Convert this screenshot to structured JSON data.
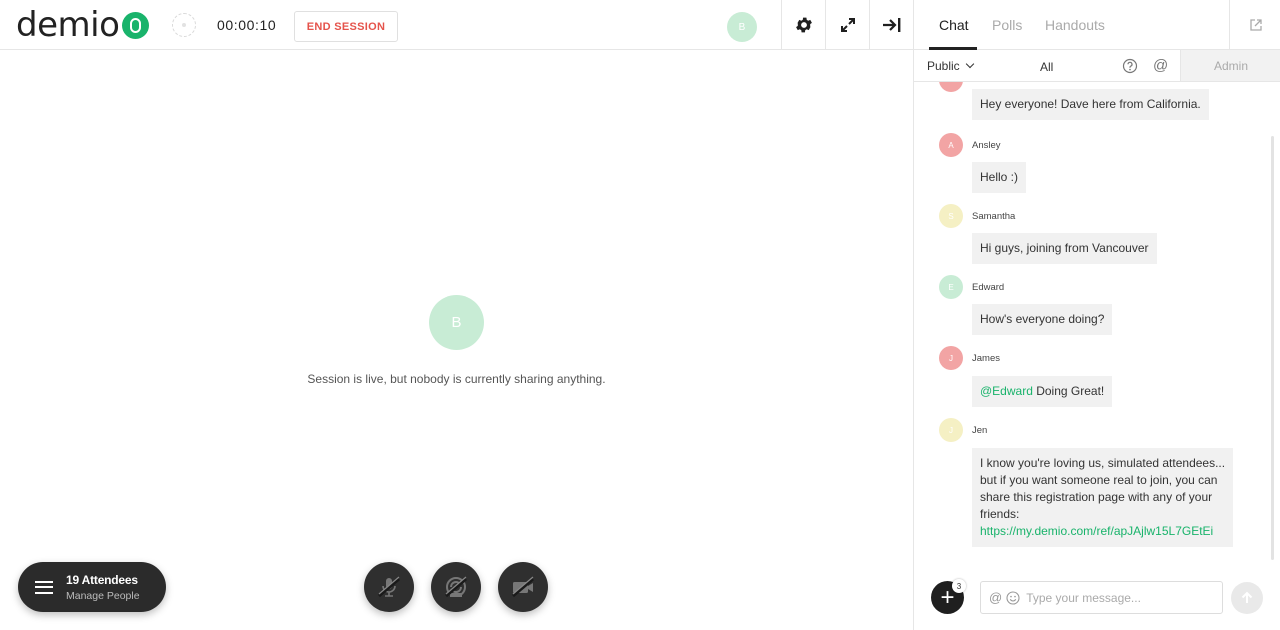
{
  "header": {
    "logo_text": "demio",
    "timer": "00:00:10",
    "end_session_label": "END SESSION",
    "host_avatar_initial": "B"
  },
  "stage": {
    "avatar_initial": "B",
    "message": "Session is live, but nobody is currently sharing anything."
  },
  "attendees": {
    "count_label": "19 Attendees",
    "sub_label": "Manage People"
  },
  "panel": {
    "tabs": [
      {
        "label": "Chat",
        "active": true
      },
      {
        "label": "Polls",
        "active": false
      },
      {
        "label": "Handouts",
        "active": false
      }
    ],
    "filter": {
      "visibility": "Public",
      "audience": "All",
      "admin_label": "Admin"
    }
  },
  "chat": {
    "messages": [
      {
        "name": "",
        "initial": "",
        "color": "#f2a4a4",
        "text": "Hey everyone! Dave here from California."
      },
      {
        "name": "Ansley",
        "initial": "A",
        "color": "#f2a4a4",
        "text": "Hello :)"
      },
      {
        "name": "Samantha",
        "initial": "S",
        "color": "#f5f0c4",
        "text": "Hi guys, joining from Vancouver"
      },
      {
        "name": "Edward",
        "initial": "E",
        "color": "#c8ecd5",
        "text": "How's everyone doing?"
      },
      {
        "name": "James",
        "initial": "J",
        "color": "#f2a4a4",
        "mention": "@Edward",
        "text": " Doing Great!"
      },
      {
        "name": "Jen",
        "initial": "J",
        "color": "#f5f0c4",
        "lines": [
          "I know you're loving us, simulated attendees...",
          "but if you want someone real to join, you can",
          "share this registration page with any of your",
          "friends:"
        ],
        "link": "https://my.demio.com/ref/apJAjlw15L7GEtEi"
      }
    ]
  },
  "compose": {
    "placeholder": "Type your message...",
    "badge_count": "3"
  },
  "colors": {
    "brand_green": "#19b36b",
    "end_session_red": "#e5534b",
    "dark_button": "#2b2b2b"
  }
}
